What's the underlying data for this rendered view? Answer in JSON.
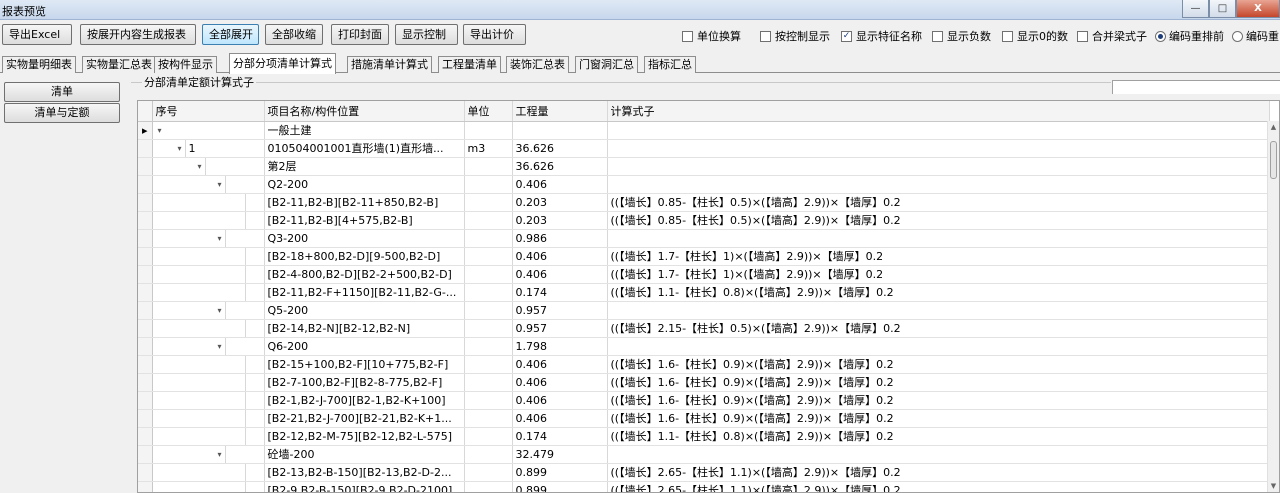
{
  "window": {
    "title": "报表预览",
    "minimize": "—",
    "maximize": "□",
    "close": "X"
  },
  "toolbar": {
    "buttons": [
      {
        "label": "导出Excel"
      },
      {
        "label": "按展开内容生成报表"
      },
      {
        "label": "全部展开",
        "active": true
      },
      {
        "label": "全部收缩"
      },
      {
        "label": "打印封面"
      },
      {
        "label": "显示控制"
      },
      {
        "label": "导出计价"
      }
    ],
    "options": [
      {
        "label": "单位换算",
        "checked": false
      },
      {
        "label": "按控制显示",
        "checked": false
      },
      {
        "label": "显示特征名称",
        "checked": true
      },
      {
        "label": "显示负数",
        "checked": false
      },
      {
        "label": "显示0的数",
        "checked": false
      },
      {
        "label": "合并梁式子",
        "checked": false
      }
    ],
    "radios": [
      {
        "label": "编码重排前",
        "selected": true
      },
      {
        "label": "编码重",
        "selected": false
      }
    ]
  },
  "tabs": [
    {
      "label": "实物量明细表"
    },
    {
      "label": "实物量汇总表"
    },
    {
      "label": "按构件显示"
    },
    {
      "label": "分部分项清单计算式",
      "active": true
    },
    {
      "label": "措施清单计算式"
    },
    {
      "label": "工程量清单"
    },
    {
      "label": "装饰汇总表"
    },
    {
      "label": "门窗洞汇总"
    },
    {
      "label": "指标汇总"
    }
  ],
  "left_panel": {
    "buttons": [
      {
        "label": "清单"
      },
      {
        "label": "清单与定额"
      }
    ]
  },
  "group": {
    "label": "分部清单定额计算式子"
  },
  "grid": {
    "columns": [
      "序号",
      "项目名称/构件位置",
      "单位",
      "工程量",
      "计算式子"
    ],
    "rows": [
      {
        "level": 0,
        "expander": "▾",
        "seq": "",
        "name": "一般土建",
        "unit": "",
        "qty": "",
        "formula": "",
        "current": true
      },
      {
        "level": 1,
        "expander": "▾",
        "seq": "1",
        "name": "010504001001直形墙(1)直形墙...",
        "unit": "m3",
        "qty": "36.626",
        "formula": ""
      },
      {
        "level": 2,
        "expander": "▾",
        "seq": "",
        "name": "第2层",
        "unit": "",
        "qty": "36.626",
        "formula": ""
      },
      {
        "level": 3,
        "expander": "▾",
        "seq": "",
        "name": "Q2-200",
        "unit": "",
        "qty": "0.406",
        "formula": ""
      },
      {
        "level": 4,
        "expander": "",
        "seq": "",
        "name": "[B2-11,B2-B][B2-11+850,B2-B]",
        "unit": "",
        "qty": "0.203",
        "formula": "((【墙长】0.85-【柱长】0.5)×(【墙高】2.9))×【墙厚】0.2"
      },
      {
        "level": 4,
        "expander": "",
        "seq": "",
        "name": "[B2-11,B2-B][4+575,B2-B]",
        "unit": "",
        "qty": "0.203",
        "formula": "((【墙长】0.85-【柱长】0.5)×(【墙高】2.9))×【墙厚】0.2"
      },
      {
        "level": 3,
        "expander": "▾",
        "seq": "",
        "name": "Q3-200",
        "unit": "",
        "qty": "0.986",
        "formula": ""
      },
      {
        "level": 4,
        "expander": "",
        "seq": "",
        "name": "[B2-18+800,B2-D][9-500,B2-D]",
        "unit": "",
        "qty": "0.406",
        "formula": "((【墙长】1.7-【柱长】1)×(【墙高】2.9))×【墙厚】0.2"
      },
      {
        "level": 4,
        "expander": "",
        "seq": "",
        "name": "[B2-4-800,B2-D][B2-2+500,B2-D]",
        "unit": "",
        "qty": "0.406",
        "formula": "((【墙长】1.7-【柱长】1)×(【墙高】2.9))×【墙厚】0.2"
      },
      {
        "level": 4,
        "expander": "",
        "seq": "",
        "name": "[B2-11,B2-F+1150][B2-11,B2-G-...",
        "unit": "",
        "qty": "0.174",
        "formula": "((【墙长】1.1-【柱长】0.8)×(【墙高】2.9))×【墙厚】0.2"
      },
      {
        "level": 3,
        "expander": "▾",
        "seq": "",
        "name": "Q5-200",
        "unit": "",
        "qty": "0.957",
        "formula": ""
      },
      {
        "level": 4,
        "expander": "",
        "seq": "",
        "name": "[B2-14,B2-N][B2-12,B2-N]",
        "unit": "",
        "qty": "0.957",
        "formula": "((【墙长】2.15-【柱长】0.5)×(【墙高】2.9))×【墙厚】0.2"
      },
      {
        "level": 3,
        "expander": "▾",
        "seq": "",
        "name": "Q6-200",
        "unit": "",
        "qty": "1.798",
        "formula": ""
      },
      {
        "level": 4,
        "expander": "",
        "seq": "",
        "name": "[B2-15+100,B2-F][10+775,B2-F]",
        "unit": "",
        "qty": "0.406",
        "formula": "((【墙长】1.6-【柱长】0.9)×(【墙高】2.9))×【墙厚】0.2"
      },
      {
        "level": 4,
        "expander": "",
        "seq": "",
        "name": "[B2-7-100,B2-F][B2-8-775,B2-F]",
        "unit": "",
        "qty": "0.406",
        "formula": "((【墙长】1.6-【柱长】0.9)×(【墙高】2.9))×【墙厚】0.2"
      },
      {
        "level": 4,
        "expander": "",
        "seq": "",
        "name": "[B2-1,B2-J-700][B2-1,B2-K+100]",
        "unit": "",
        "qty": "0.406",
        "formula": "((【墙长】1.6-【柱长】0.9)×(【墙高】2.9))×【墙厚】0.2"
      },
      {
        "level": 4,
        "expander": "",
        "seq": "",
        "name": "[B2-21,B2-J-700][B2-21,B2-K+1...",
        "unit": "",
        "qty": "0.406",
        "formula": "((【墙长】1.6-【柱长】0.9)×(【墙高】2.9))×【墙厚】0.2"
      },
      {
        "level": 4,
        "expander": "",
        "seq": "",
        "name": "[B2-12,B2-M-75][B2-12,B2-L-575]",
        "unit": "",
        "qty": "0.174",
        "formula": "((【墙长】1.1-【柱长】0.8)×(【墙高】2.9))×【墙厚】0.2"
      },
      {
        "level": 3,
        "expander": "▾",
        "seq": "",
        "name": "砼墙-200",
        "unit": "",
        "qty": "32.479",
        "formula": ""
      },
      {
        "level": 4,
        "expander": "",
        "seq": "",
        "name": "[B2-13,B2-B-150][B2-13,B2-D-2...",
        "unit": "",
        "qty": "0.899",
        "formula": "((【墙长】2.65-【柱长】1.1)×(【墙高】2.9))×【墙厚】0.2"
      },
      {
        "level": 4,
        "expander": "",
        "seq": "",
        "name": "[B2-9,B2-B-150][B2-9,B2-D-2100]",
        "unit": "",
        "qty": "0.899",
        "formula": "((【墙长】2.65-【柱长】1.1)×(【墙高】2.9))×【墙厚】0.2"
      }
    ]
  }
}
